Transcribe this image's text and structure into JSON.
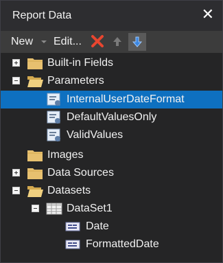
{
  "panel": {
    "title": "Report Data",
    "close_glyph": "✕"
  },
  "toolbar": {
    "new_label": "New",
    "edit_label": "Edit...",
    "delete_icon": "red-x-icon",
    "move_up_icon": "arrow-up-icon",
    "move_down_icon": "arrow-down-icon"
  },
  "tree": {
    "builtin_fields": "Built-in Fields",
    "parameters": "Parameters",
    "param_internal_user_date_format": "InternalUserDateFormat",
    "param_default_values_only": "DefaultValuesOnly",
    "param_valid_values": "ValidValues",
    "images": "Images",
    "data_sources": "Data Sources",
    "datasets": "Datasets",
    "dataset1": "DataSet1",
    "field_date": "Date",
    "field_formatted_date": "FormattedDate"
  },
  "colors": {
    "selection": "#0e70c0",
    "delete": "#e8462f",
    "folder": "#e7c06f"
  }
}
